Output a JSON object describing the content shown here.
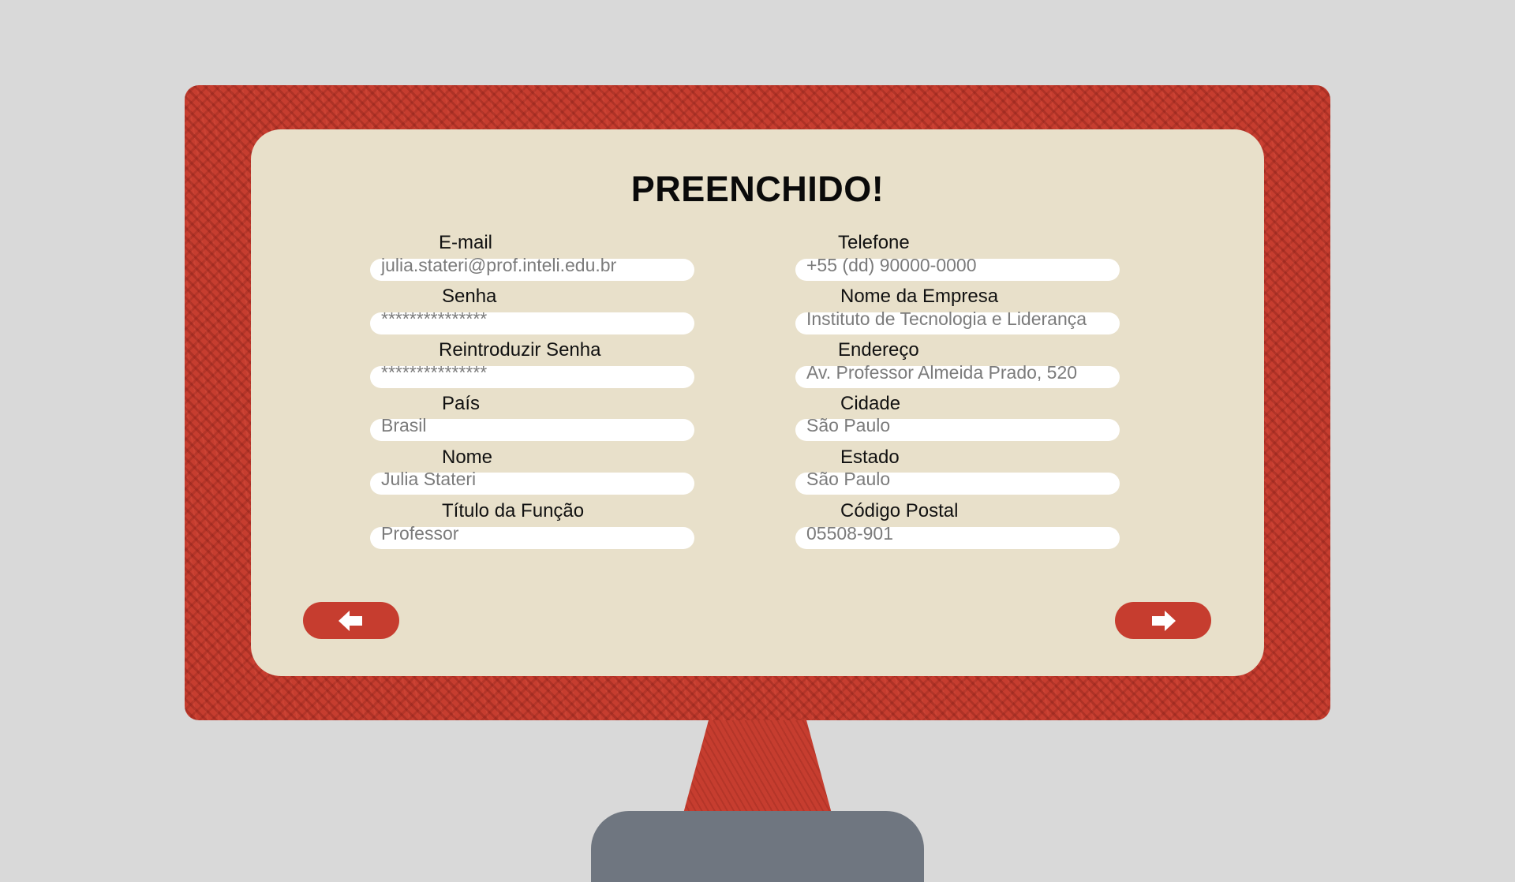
{
  "form": {
    "title": "PREENCHIDO!",
    "left_fields": [
      {
        "label": "E-mail",
        "value": "julia.stateri@prof.inteli.edu.br"
      },
      {
        "label": "Senha",
        "value": "***************"
      },
      {
        "label": "Reintroduzir Senha",
        "value": "***************"
      },
      {
        "label": "País",
        "value": "Brasil"
      },
      {
        "label": "Nome",
        "value": "Julia Stateri"
      },
      {
        "label": "Título da Função",
        "value": "Professor"
      }
    ],
    "right_fields": [
      {
        "label": "Telefone",
        "value": "+55 (dd) 90000-0000"
      },
      {
        "label": "Nome da Empresa",
        "value": "Instituto de Tecnologia e Liderança"
      },
      {
        "label": "Endereço",
        "value": "Av. Professor Almeida Prado, 520"
      },
      {
        "label": "Cidade",
        "value": "São Paulo"
      },
      {
        "label": "Estado",
        "value": "São Paulo"
      },
      {
        "label": "Código Postal",
        "value": "05508-901"
      }
    ]
  },
  "navigation": {
    "back_icon": "arrow-left-icon",
    "next_icon": "arrow-right-icon"
  },
  "colors": {
    "frame": "#c63d2f",
    "panel": "#e8e0ca",
    "background": "#d9d9d9",
    "stand_base": "#6f7680",
    "input_text": "#7b7b7b"
  }
}
